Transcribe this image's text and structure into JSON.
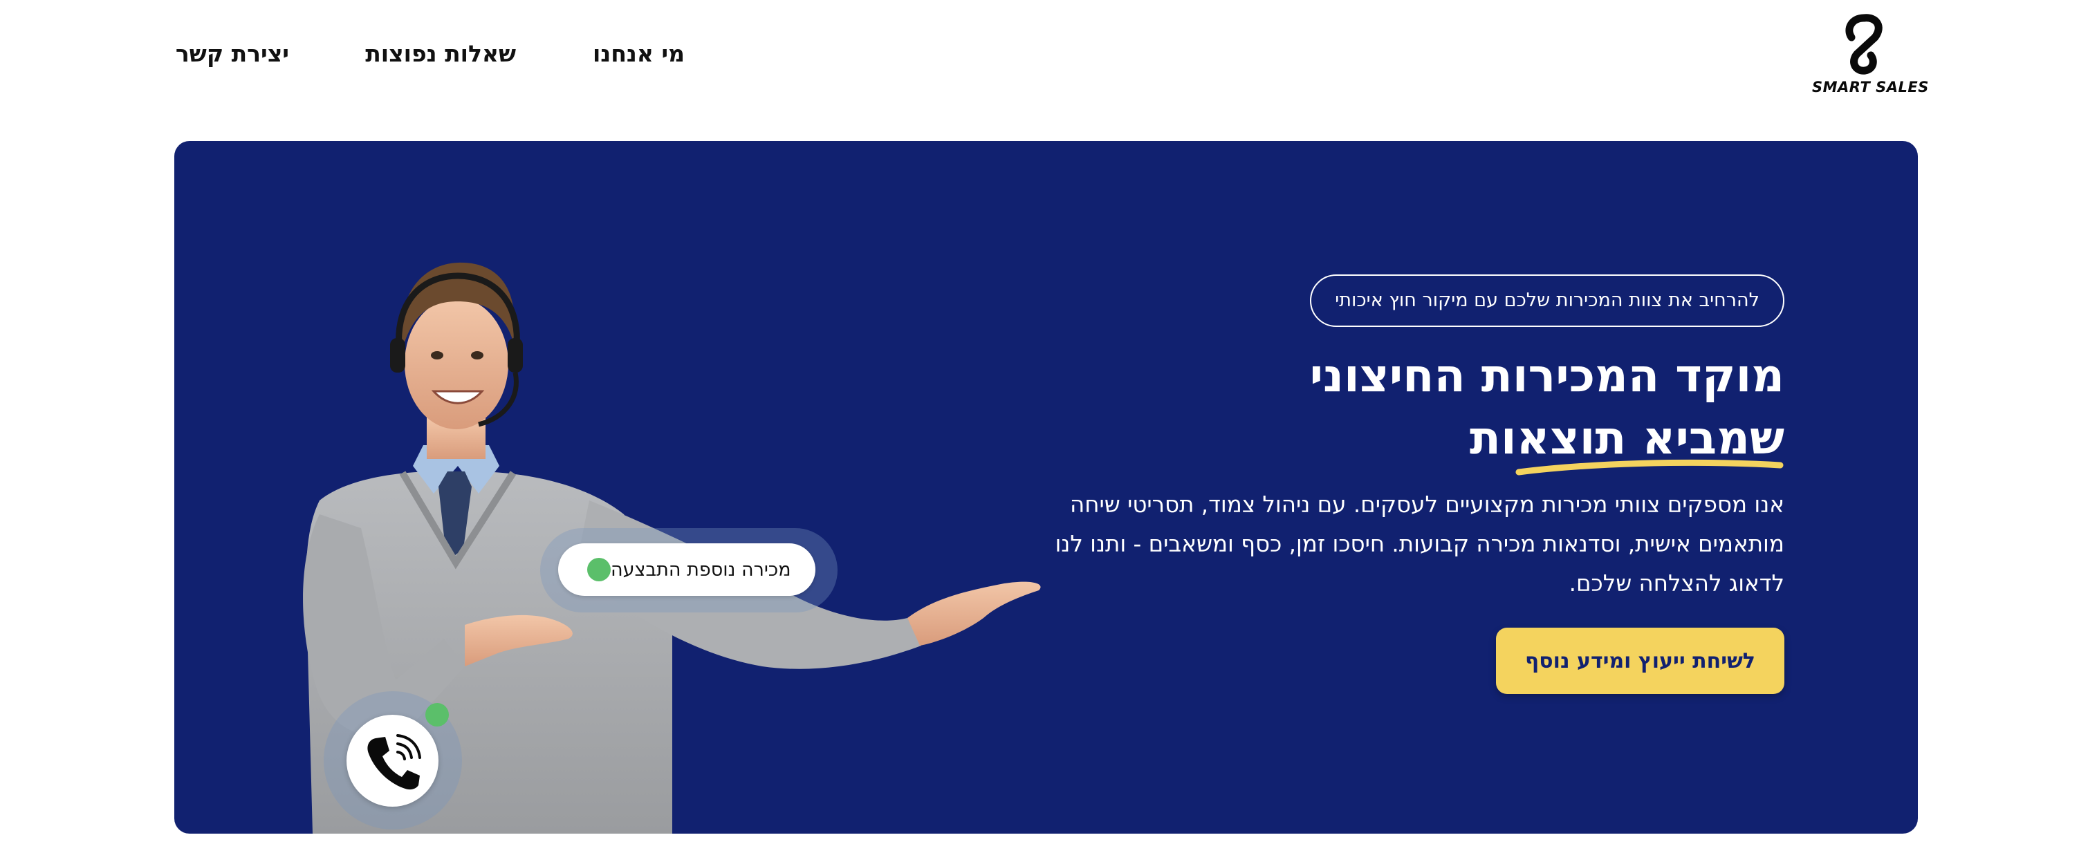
{
  "header": {
    "logo_text": "SMART SALES",
    "nav": {
      "about": "מי אנחנו",
      "faq": "שאלות נפוצות",
      "contact": "יצירת קשר"
    }
  },
  "hero": {
    "tagline": "להרחיב את צוות המכירות שלכם עם מיקור חוץ איכותי",
    "headline_line1": "מוקד המכירות החיצוני",
    "headline_line2": "שמביא תוצאות",
    "description": "אנו מספקים צוותי מכירות מקצועיים לעסקים. עם ניהול צמוד, תסריטי שיחה מותאמים אישית, וסדנאות מכירה קבועות. חיסכו זמן, כסף ומשאבים - ותנו לנו לדאוג להצלחה שלכם.",
    "cta_label": "לשיחת ייעוץ ומידע נוסף",
    "sale_notification": "מכירה נוספת התבצעה"
  },
  "colors": {
    "hero_background": "#112170",
    "accent_yellow": "#f4d35e",
    "status_green": "#5bbf6a"
  },
  "icons": {
    "logo": "smart-sales-s-logo-icon",
    "phone": "phone-ringing-icon"
  }
}
